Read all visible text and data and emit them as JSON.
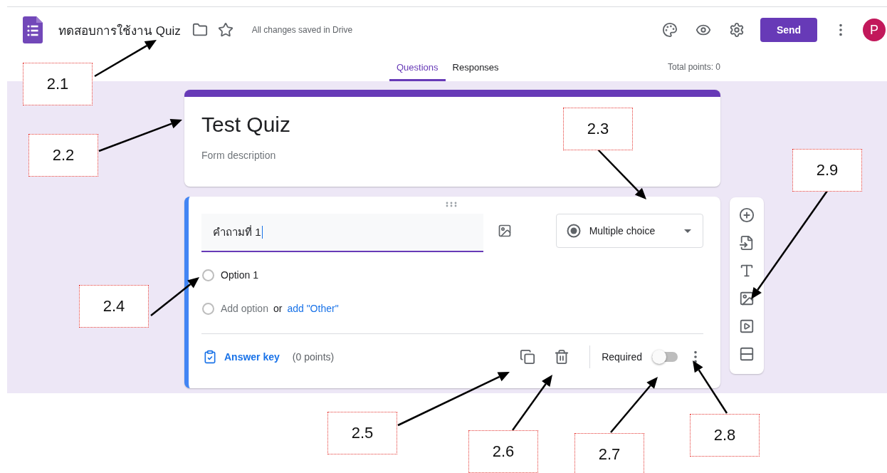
{
  "header": {
    "title": "ทดสอบการใช้งาน Quiz",
    "save_status": "All changes saved in Drive",
    "send_button": "Send",
    "avatar": "P"
  },
  "tabs": [
    {
      "label": "Questions",
      "selected": true
    },
    {
      "label": "Responses",
      "selected": false
    }
  ],
  "total_points": "Total points: 0",
  "form": {
    "title": "Test Quiz",
    "description": {
      "placeholder": "Form description"
    }
  },
  "question": {
    "title": "คำถามที่ 1",
    "type": "Multiple choice",
    "options": [
      {
        "label": "Option 1",
        "checked": false
      }
    ],
    "add_option": "Add option",
    "add_option_checked": false,
    "or": "or",
    "add_other": "add \"Other\"",
    "answer_key": "Answer key",
    "points": "(0 points)",
    "required_label": "Required",
    "required": false
  },
  "annotations": [
    {
      "label": "2.1"
    },
    {
      "label": "2.2"
    },
    {
      "label": "2.3"
    },
    {
      "label": "2.4"
    },
    {
      "label": "2.5"
    },
    {
      "label": "2.6"
    },
    {
      "label": "2.7"
    },
    {
      "label": "2.8"
    },
    {
      "label": "2.9"
    }
  ]
}
